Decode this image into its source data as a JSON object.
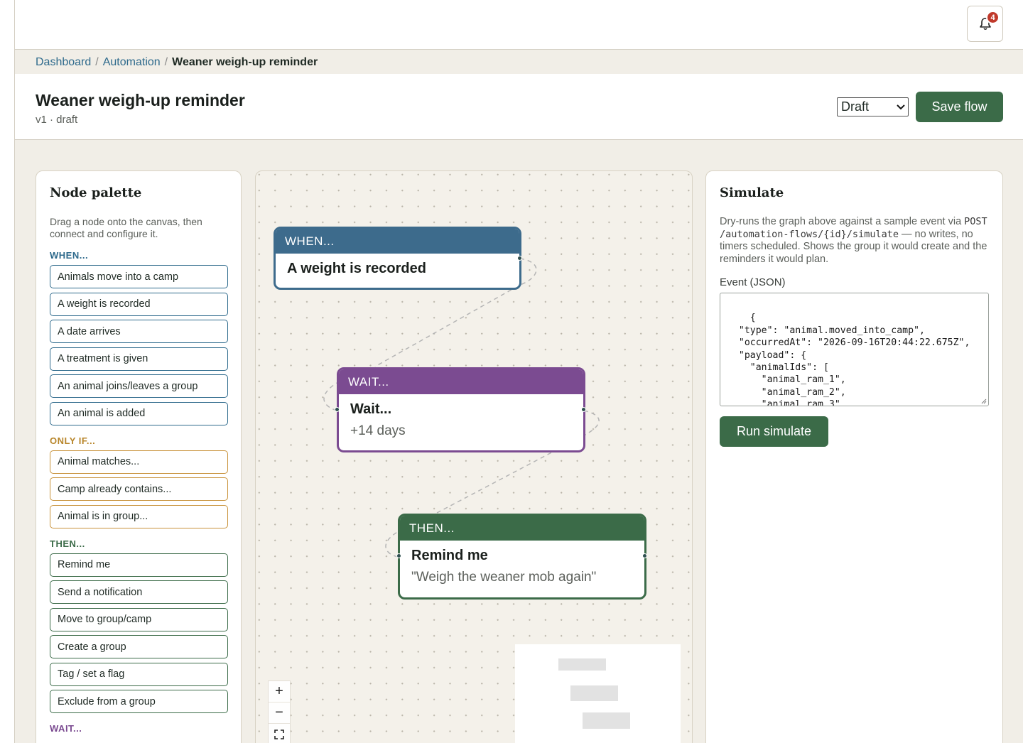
{
  "notifications": {
    "count": "4",
    "icon": "bell-icon"
  },
  "breadcrumb": [
    {
      "label": "Dashboard"
    },
    {
      "label": "Automation"
    },
    {
      "label": "Weaner weigh-up reminder"
    }
  ],
  "breadcrumb_separator": "/",
  "header": {
    "title": "Weaner weigh-up reminder",
    "subtitle": "v1 · draft",
    "status_value": "Draft",
    "save_label": "Save flow"
  },
  "palette": {
    "title": "Node palette",
    "description": "Drag a node onto the canvas, then connect and configure it.",
    "sections": {
      "when": {
        "label": "WHEN...",
        "items": [
          "Animals move into a camp",
          "A weight is recorded",
          "A date arrives",
          "A treatment is given",
          "An animal joins/leaves a group",
          "An animal is added"
        ]
      },
      "only_if": {
        "label": "ONLY IF...",
        "items": [
          "Animal matches...",
          "Camp already contains...",
          "Animal is in group..."
        ]
      },
      "then": {
        "label": "THEN...",
        "items": [
          "Remind me",
          "Send a notification",
          "Move to group/camp",
          "Create a group",
          "Tag / set a flag",
          "Exclude from a group"
        ]
      },
      "wait": {
        "label": "WAIT..."
      }
    }
  },
  "canvas": {
    "nodes": {
      "when": {
        "header": "WHEN...",
        "title": "A weight is recorded"
      },
      "wait": {
        "header": "WAIT...",
        "title": "Wait...",
        "detail": "+14 days"
      },
      "then": {
        "header": "THEN...",
        "title": "Remind me",
        "detail": "\"Weigh the weaner mob again\""
      }
    },
    "zoom": {
      "in": "+",
      "out": "−",
      "fit": "fit-view-icon"
    }
  },
  "simulate": {
    "title": "Simulate",
    "description_before": "Dry-runs the graph above against a sample event via ",
    "endpoint": "POST /automation-flows/{id}/simulate",
    "description_after": " — no writes, no timers scheduled. Shows the group it would create and the reminders it would plan.",
    "event_label": "Event (JSON)",
    "event_json": "{\n  \"type\": \"animal.moved_into_camp\",\n  \"occurredAt\": \"2026-09-16T20:44:22.675Z\",\n  \"payload\": {\n    \"animalIds\": [\n      \"animal_ram_1\",\n      \"animal_ram_2\",\n      \"animal_ram_3\"",
    "run_label": "Run simulate"
  },
  "colors": {
    "when": "#3d6b8c",
    "wait": "#7b4b91",
    "then": "#3b6b48",
    "only_if": "#c8923a",
    "primary_button": "#3b6b48",
    "badge": "#c0392b"
  }
}
